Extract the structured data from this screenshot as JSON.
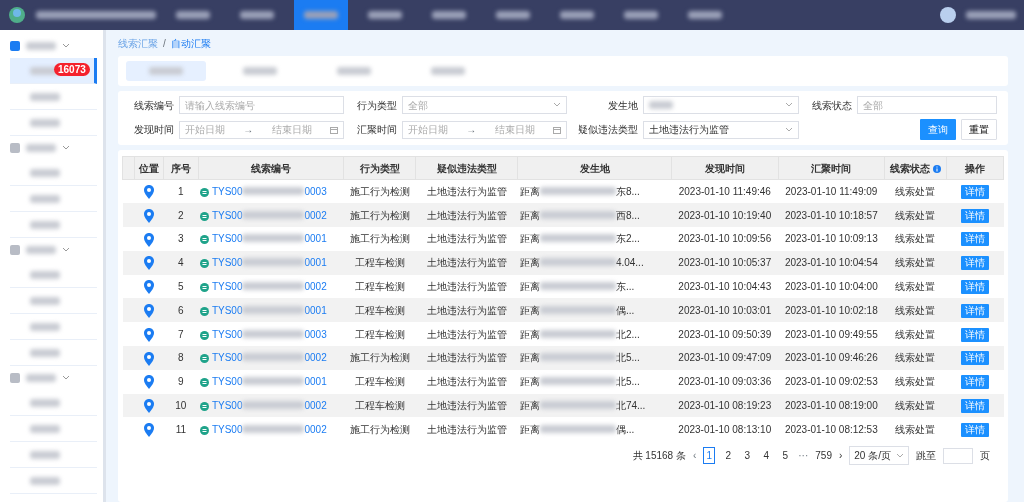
{
  "topbar": {
    "nav_items": [
      {
        "selected": false
      },
      {
        "selected": false
      },
      {
        "selected": true
      },
      {
        "selected": false
      },
      {
        "selected": false
      },
      {
        "selected": false
      },
      {
        "selected": false
      },
      {
        "selected": false
      },
      {
        "selected": false
      }
    ]
  },
  "sidebar": {
    "groups": [
      {
        "expanded": true,
        "children": [
          {
            "selected": true,
            "badge": "16073"
          },
          {
            "selected": false
          },
          {
            "selected": false
          }
        ]
      },
      {
        "expanded": true,
        "children": [
          {
            "selected": false
          },
          {
            "selected": false
          },
          {
            "selected": false
          }
        ]
      },
      {
        "expanded": true,
        "children": [
          {
            "selected": false
          },
          {
            "selected": false
          },
          {
            "selected": false
          },
          {
            "selected": false
          }
        ]
      },
      {
        "expanded": true,
        "children": [
          {
            "selected": false
          },
          {
            "selected": false
          },
          {
            "selected": false
          },
          {
            "selected": false
          }
        ]
      }
    ]
  },
  "breadcrumb": {
    "items": [
      "线索汇聚",
      "自动汇聚"
    ],
    "separator": "/"
  },
  "tabs": [
    {
      "selected": true
    },
    {
      "selected": false
    },
    {
      "selected": false
    },
    {
      "selected": false
    }
  ],
  "filters": [
    {
      "kind": "text",
      "label": "线索编号",
      "placeholder": "请输入线索编号"
    },
    {
      "kind": "select",
      "label": "行为类型",
      "placeholder": "全部"
    },
    {
      "kind": "select",
      "label": "发生地"
    },
    {
      "kind": "text",
      "label": "线索状态",
      "placeholder": "全部"
    },
    {
      "kind": "date",
      "label": "发现时间",
      "start": "开始日期",
      "separator": "→",
      "end": "结束日期"
    },
    {
      "kind": "date",
      "label": "汇聚时间",
      "start": "开始日期",
      "separator": "→",
      "end": "结束日期"
    },
    {
      "kind": "select",
      "label": "疑似违法类型",
      "value": "土地违法行为监管"
    }
  ],
  "buttons": [
    "查询",
    "重置"
  ],
  "table": {
    "columns": [
      "位置",
      "序号",
      "线索编号",
      "行为类型",
      "疑似违法类型",
      "发生地",
      "发现时间",
      "汇聚时间",
      "线索状态",
      "操作"
    ],
    "rows": [
      {
        "index": "1",
        "id_prefix": "TYS00",
        "id_suffix": "0003",
        "behavior": "施工行为检测",
        "violation": "土地违法行为监管",
        "place_prefix": "距离",
        "place_suffix": "东8...",
        "found": "2023-01-10 11:49:46",
        "gathered": "2023-01-10 11:49:09",
        "status": "线索处置",
        "action": "详情"
      },
      {
        "index": "2",
        "id_prefix": "TYS00",
        "id_suffix": "0002",
        "behavior": "施工行为检测",
        "violation": "土地违法行为监管",
        "place_prefix": "距离",
        "place_suffix": "西8...",
        "found": "2023-01-10 10:19:40",
        "gathered": "2023-01-10 10:18:57",
        "status": "线索处置",
        "action": "详情"
      },
      {
        "index": "3",
        "id_prefix": "TYS00",
        "id_suffix": "0001",
        "behavior": "施工行为检测",
        "violation": "土地违法行为监管",
        "place_prefix": "距离",
        "place_suffix": "东2...",
        "found": "2023-01-10 10:09:56",
        "gathered": "2023-01-10 10:09:13",
        "status": "线索处置",
        "action": "详情"
      },
      {
        "index": "4",
        "id_prefix": "TYS00",
        "id_suffix": "0001",
        "behavior": "工程车检测",
        "violation": "土地违法行为监管",
        "place_prefix": "距离",
        "place_suffix": "4.04...",
        "found": "2023-01-10 10:05:37",
        "gathered": "2023-01-10 10:04:54",
        "status": "线索处置",
        "action": "详情"
      },
      {
        "index": "5",
        "id_prefix": "TYS00",
        "id_suffix": "0002",
        "behavior": "工程车检测",
        "violation": "土地违法行为监管",
        "place_prefix": "距离",
        "place_suffix": "东...",
        "found": "2023-01-10 10:04:43",
        "gathered": "2023-01-10 10:04:00",
        "status": "线索处置",
        "action": "详情"
      },
      {
        "index": "6",
        "id_prefix": "TYS00",
        "id_suffix": "0001",
        "behavior": "工程车检测",
        "violation": "土地违法行为监管",
        "place_prefix": "距离",
        "place_suffix": "偶...",
        "found": "2023-01-10 10:03:01",
        "gathered": "2023-01-10 10:02:18",
        "status": "线索处置",
        "action": "详情"
      },
      {
        "index": "7",
        "id_prefix": "TYS00",
        "id_suffix": "0003",
        "behavior": "工程车检测",
        "violation": "土地违法行为监管",
        "place_prefix": "距离",
        "place_suffix": "北2...",
        "found": "2023-01-10 09:50:39",
        "gathered": "2023-01-10 09:49:55",
        "status": "线索处置",
        "action": "详情"
      },
      {
        "index": "8",
        "id_prefix": "TYS00",
        "id_suffix": "0002",
        "behavior": "施工行为检测",
        "violation": "土地违法行为监管",
        "place_prefix": "距离",
        "place_suffix": "北5...",
        "found": "2023-01-10 09:47:09",
        "gathered": "2023-01-10 09:46:26",
        "status": "线索处置",
        "action": "详情"
      },
      {
        "index": "9",
        "id_prefix": "TYS00",
        "id_suffix": "0001",
        "behavior": "工程车检测",
        "violation": "土地违法行为监管",
        "place_prefix": "距离",
        "place_suffix": "北5...",
        "found": "2023-01-10 09:03:36",
        "gathered": "2023-01-10 09:02:53",
        "status": "线索处置",
        "action": "详情"
      },
      {
        "index": "10",
        "id_prefix": "TYS00",
        "id_suffix": "0002",
        "behavior": "工程车检测",
        "violation": "土地违法行为监管",
        "place_prefix": "距离",
        "place_suffix": "北74...",
        "found": "2023-01-10 08:19:23",
        "gathered": "2023-01-10 08:19:00",
        "status": "线索处置",
        "action": "详情"
      },
      {
        "index": "11",
        "id_prefix": "TYS00",
        "id_suffix": "0002",
        "behavior": "施工行为检测",
        "violation": "土地违法行为监管",
        "place_prefix": "距离",
        "place_suffix": "偶...",
        "found": "2023-01-10 08:13:10",
        "gathered": "2023-01-10 08:12:53",
        "status": "线索处置",
        "action": "详情"
      }
    ]
  },
  "pagination": {
    "total": "共 15168 条",
    "prev": "‹",
    "pages": [
      {
        "label": "1",
        "selected": true
      },
      {
        "label": "2",
        "selected": false
      },
      {
        "label": "3",
        "selected": false
      },
      {
        "label": "4",
        "selected": false
      },
      {
        "label": "5",
        "selected": false
      }
    ],
    "ellipsis": "···",
    "last": "759",
    "next": "›",
    "page_size": "20 条/页",
    "jump_label": "跳至",
    "page_unit": "页"
  }
}
